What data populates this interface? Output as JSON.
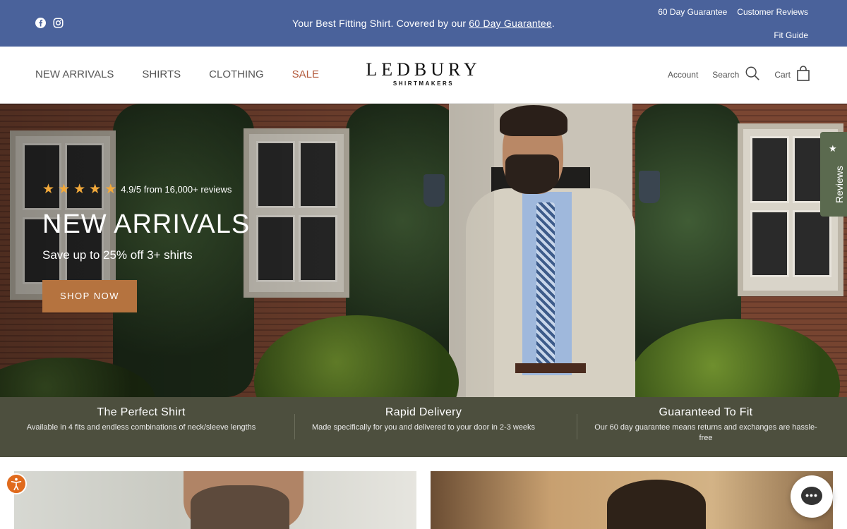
{
  "announcement": {
    "social": [
      {
        "icon": "facebook-icon"
      },
      {
        "icon": "instagram-icon"
      }
    ],
    "promo_text": "Your Best Fitting Shirt. Covered by our ",
    "promo_link": "60 Day Guarantee",
    "promo_end": ".",
    "links": [
      "60 Day Guarantee",
      "Customer Reviews",
      "Fit Guide"
    ]
  },
  "header": {
    "nav": [
      "NEW ARRIVALS",
      "SHIRTS",
      "CLOTHING",
      "SALE"
    ],
    "logo": {
      "name": "LEDBURY",
      "sub": "SHIRTMAKERS"
    },
    "util": {
      "account": "Account",
      "search": "Search",
      "cart": "Cart"
    }
  },
  "hero": {
    "rating_text": "4.9/5 from 16,000+ reviews",
    "stars": 5,
    "title": "NEW ARRIVALS",
    "subtitle": "Save up to 25% off 3+ shirts",
    "cta": "SHOP NOW",
    "reviews_tab": "Reviews"
  },
  "features": [
    {
      "title": "The Perfect Shirt",
      "text": "Available in 4 fits and endless combinations of neck/sleeve lengths"
    },
    {
      "title": "Rapid Delivery",
      "text": "Made specifically for you and delivered to your door in 2-3 weeks"
    },
    {
      "title": "Guaranteed To Fit",
      "text": "Our 60 day guarantee means returns and exchanges are hassle-free"
    }
  ],
  "colors": {
    "announcement_bg": "#4a629b",
    "sale": "#b35a3c",
    "cta": "#b5733f",
    "features_bg": "#4d4f3e",
    "star": "#f2a93b"
  }
}
